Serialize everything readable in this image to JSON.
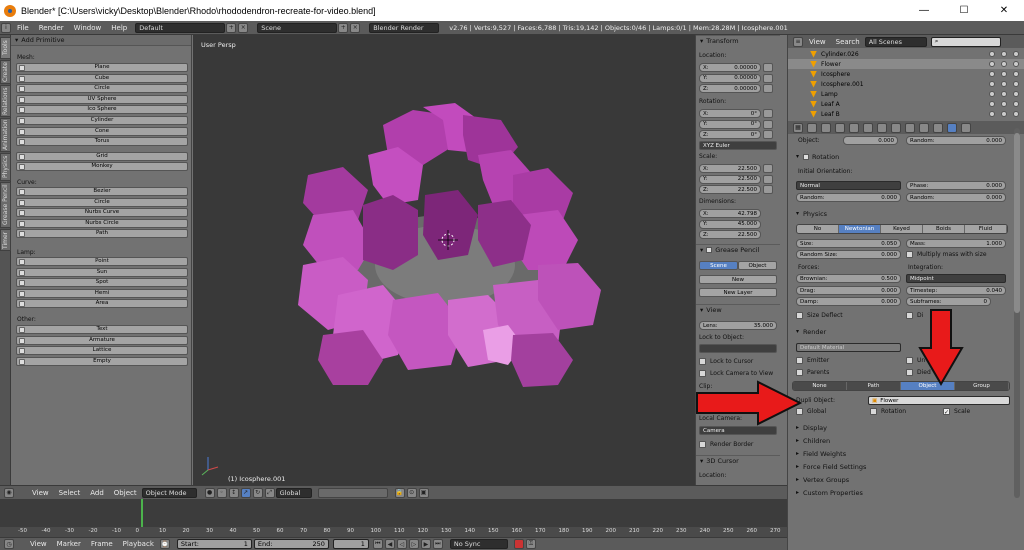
{
  "window": {
    "title": "Blender* [C:\\Users\\vicky\\Desktop\\Blender\\Rhodo\\rhododendron-recreate-for-video.blend]",
    "minimize": "—",
    "maximize": "☐",
    "close": "✕"
  },
  "info_header": {
    "menus": [
      "File",
      "Render",
      "Window",
      "Help"
    ],
    "layout": "Default",
    "scene": "Scene",
    "engine": "Blender Render",
    "stats": "v2.76 | Verts:9,527 | Faces:6,788 | Tris:19,142 | Objects:0/46 | Lamps:0/1 | Mem:28.28M | Icosphere.001"
  },
  "tool_tabs": [
    "Tools",
    "Create",
    "Relations",
    "Animation",
    "Physics",
    "Grease Pencil",
    "Timer"
  ],
  "tool_shelf": {
    "panel_title": "Add Primitive",
    "sections": {
      "mesh": "Mesh:",
      "curve": "Curve:",
      "lamp": "Lamp:",
      "other": "Other:"
    },
    "mesh_buttons": [
      "Plane",
      "Cube",
      "Circle",
      "UV Sphere",
      "Ico Sphere",
      "Cylinder",
      "Cone",
      "Torus",
      "Grid",
      "Monkey"
    ],
    "curve_buttons": [
      "Bezier",
      "Circle",
      "Nurbs Curve",
      "Nurbs Circle",
      "Path"
    ],
    "lamp_buttons": [
      "Point",
      "Sun",
      "Spot",
      "Hemi",
      "Area"
    ],
    "other_buttons": [
      "Text",
      "Armature",
      "Lattice",
      "Empty"
    ]
  },
  "viewport": {
    "view_label": "User Persp",
    "object_label": "(1) Icosphere.001"
  },
  "n_panel": {
    "transform": "Transform",
    "location": "Location:",
    "loc": [
      {
        "a": "X:",
        "v": "0.00000"
      },
      {
        "a": "Y:",
        "v": "0.00000"
      },
      {
        "a": "Z:",
        "v": "0.00000"
      }
    ],
    "rotation": "Rotation:",
    "rot": [
      {
        "a": "X:",
        "v": "0°"
      },
      {
        "a": "Y:",
        "v": "0°"
      },
      {
        "a": "Z:",
        "v": "0°"
      }
    ],
    "rot_mode": "XYZ Euler",
    "scale": "Scale:",
    "scl": [
      {
        "a": "X:",
        "v": "22.500"
      },
      {
        "a": "Y:",
        "v": "22.500"
      },
      {
        "a": "Z:",
        "v": "22.500"
      }
    ],
    "dimensions": "Dimensions:",
    "dim": [
      {
        "a": "X:",
        "v": "42.798"
      },
      {
        "a": "Y:",
        "v": "45.000"
      },
      {
        "a": "Z:",
        "v": "22.500"
      }
    ],
    "grease_pencil": "Grease Pencil",
    "gp_scene": "Scene",
    "gp_object": "Object",
    "gp_new": "New",
    "gp_new_layer": "New Layer",
    "view": "View",
    "lens": "Lens:",
    "lens_value": "35.000",
    "lock_to_object": "Lock to Object:",
    "lock_to_cursor": "Lock to Cursor",
    "lock_camera": "Lock Camera to View",
    "clip": "Clip:",
    "local_camera": "Local Camera:",
    "camera": "Camera",
    "render_border": "Render Border",
    "cursor": "3D Cursor",
    "cursor_location": "Location:"
  },
  "outliner": {
    "view": "View",
    "search": "Search",
    "filter": "All Scenes",
    "rows": [
      "Cylinder.026",
      "Flower",
      "Icosphere",
      "Icosphere.001",
      "Lamp",
      "Leaf A",
      "Leaf B"
    ]
  },
  "properties": {
    "object_label": "Object:",
    "object_value": "0.000",
    "random_label": "Random:",
    "random_value": "0.000",
    "rotation": "Rotation",
    "initial_orientation": "Initial Orientation:",
    "orient_value": "Normal",
    "phase": "Phase:",
    "phase_value": "0.000",
    "rot_random": "Random:",
    "rot_random_value": "0.000",
    "rot_random2": "Random:",
    "rot_random2_value": "0.000",
    "physics": "Physics",
    "phys_tabs": [
      "No",
      "Newtonian",
      "Keyed",
      "Boids",
      "Fluid"
    ],
    "size": "Size:",
    "size_value": "0.050",
    "mass": "Mass:",
    "mass_value": "1.000",
    "random_size": "Random Size:",
    "random_size_value": "0.000",
    "multiply_mass": "Multiply mass with size",
    "forces": "Forces:",
    "integration": "Integration:",
    "brownian": "Brownian:",
    "brownian_value": "0.500",
    "midpoint": "Midpoint",
    "drag": "Drag:",
    "drag_value": "0.000",
    "timestep": "Timestep:",
    "timestep_value": "0.040",
    "damp": "Damp:",
    "damp_value": "0.000",
    "subframes": "Subframes:",
    "subframes_value": "0",
    "size_deflect": "Size Deflect",
    "die_on_hit": "Di",
    "render": "Render",
    "material": "Default Material",
    "emitter": "Emitter",
    "unborn": "Un",
    "parents": "Parents",
    "died": "Died",
    "render_tabs": [
      "None",
      "Path",
      "Object",
      "Group"
    ],
    "dupli_object": "Dupli Object:",
    "dupli_value": "Flower",
    "global": "Global",
    "rotation_chk": "Rotation",
    "scale_chk": "Scale",
    "collapsed": [
      "Display",
      "Children",
      "Field Weights",
      "Force Field Settings",
      "Vertex Groups",
      "Custom Properties"
    ]
  },
  "viewport_header": {
    "view": "View",
    "select": "Select",
    "add": "Add",
    "object": "Object",
    "mode": "Object Mode",
    "orientation": "Global"
  },
  "timeline": {
    "ticks": [
      "-50",
      "-40",
      "-30",
      "-20",
      "-10",
      "0",
      "10",
      "20",
      "30",
      "40",
      "50",
      "60",
      "70",
      "80",
      "90",
      "100",
      "110",
      "120",
      "130",
      "140",
      "150",
      "160",
      "170",
      "180",
      "190",
      "200",
      "210",
      "220",
      "230",
      "240",
      "250",
      "260",
      "270"
    ],
    "menus": [
      "View",
      "Marker",
      "Frame",
      "Playback"
    ],
    "start": "Start:",
    "start_value": "1",
    "end": "End:",
    "end_value": "250",
    "current": "1",
    "sync": "No Sync"
  },
  "colors": {
    "accent_blue": "#5680c2",
    "arrow_red": "#e81a1a",
    "flower_magenta": "#b83fb4"
  }
}
